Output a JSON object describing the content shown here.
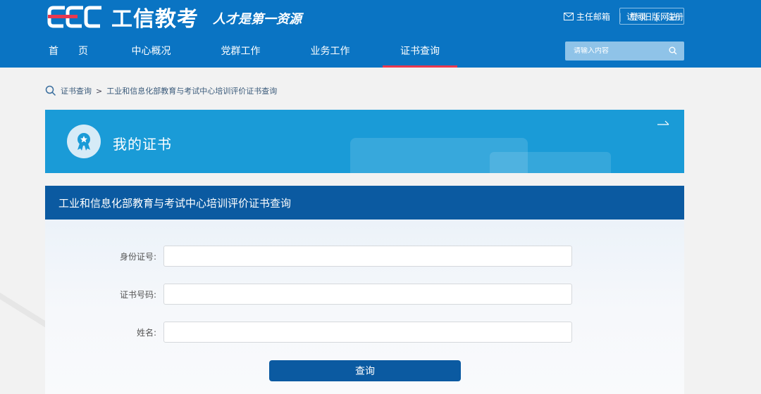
{
  "header": {
    "logo_mark": "CEC",
    "logo_cn": "工信教考",
    "slogan": "人才是第一资源",
    "top_links": {
      "mail": "主任邮箱",
      "login": "登录",
      "register": "注册",
      "old_site": "访问旧版网站"
    },
    "nav": [
      {
        "label": "首　　页"
      },
      {
        "label": "中心概况"
      },
      {
        "label": "党群工作"
      },
      {
        "label": "业务工作"
      },
      {
        "label": "证书查询"
      }
    ],
    "search_placeholder": "请输入内容",
    "colors": {
      "bar": "#0a74c3",
      "active_underline": "#e8384f"
    }
  },
  "breadcrumb": {
    "items": [
      "证书查询",
      "工业和信息化部教育与考试中心培训评价证书查询"
    ],
    "sep": ">"
  },
  "banner": {
    "title": "我的证书",
    "icon": "certificate-badge-icon",
    "color": "#1a9bd7"
  },
  "form": {
    "title": "工业和信息化部教育与考试中心培训评价证书查询",
    "fields": [
      {
        "label": "身份证号:",
        "value": ""
      },
      {
        "label": "证书号码:",
        "value": ""
      },
      {
        "label": "姓名:",
        "value": ""
      }
    ],
    "submit": "查询",
    "color": "#0b5aa1"
  }
}
